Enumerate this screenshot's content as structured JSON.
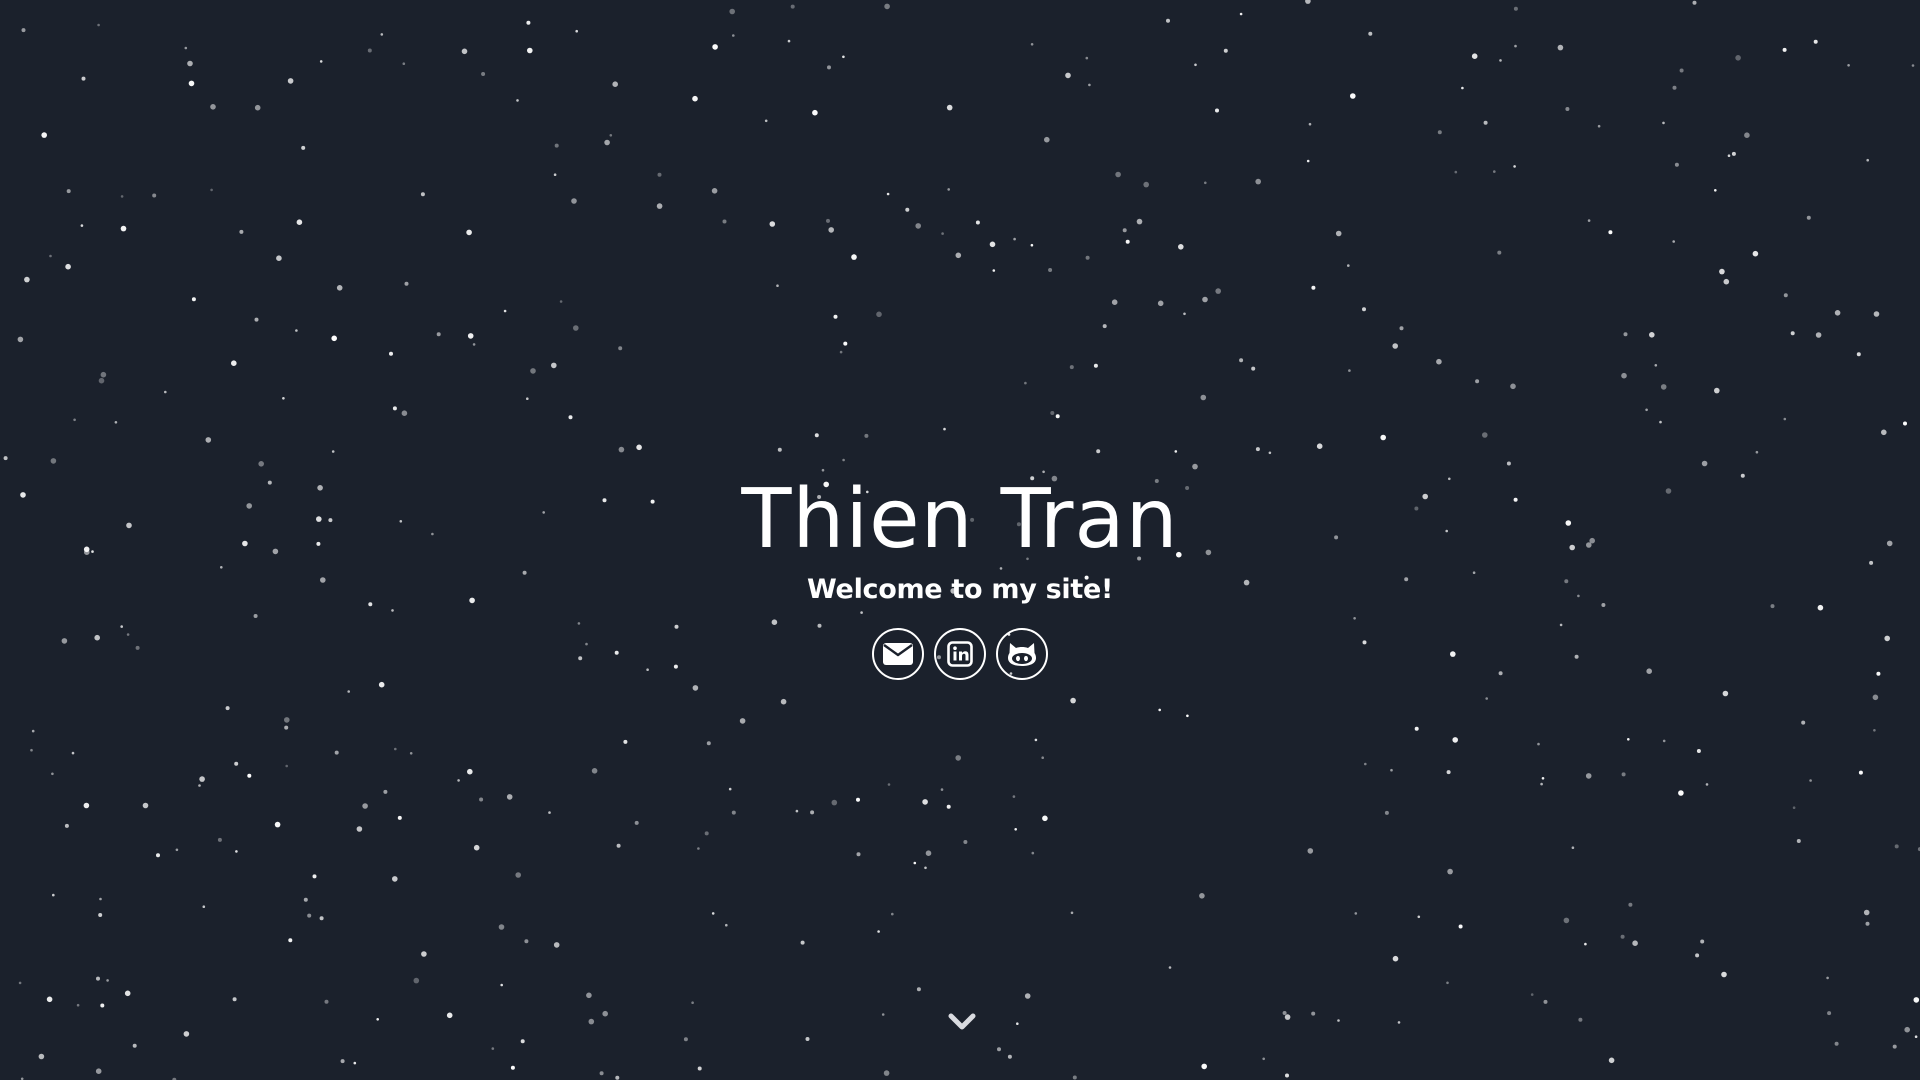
{
  "hero": {
    "title": "Thien Tran",
    "subtitle": "Welcome to my site!"
  },
  "social": [
    {
      "icon": "envelope-icon"
    },
    {
      "icon": "linkedin-icon"
    },
    {
      "icon": "github-icon"
    }
  ],
  "scroll": {
    "icon": "chevron-down-icon"
  },
  "colors": {
    "background": "#1b212c",
    "foreground": "#ffffff",
    "star": "#ffffff"
  }
}
